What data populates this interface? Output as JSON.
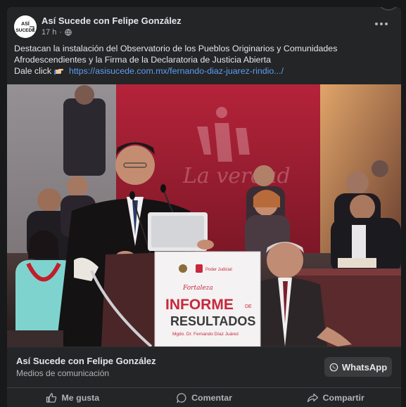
{
  "post": {
    "author": "Así Sucede con Felipe González",
    "time": "17 h",
    "separator": "·",
    "avatar_text_line1": "ASÍ",
    "avatar_text_line2": "SUCEDE",
    "text_line1": "Destacan la instalación del Observatorio de los Pueblos Originarios y Comunidades",
    "text_line2": "Afrodescendientes y la Firma de la Declaratoria de Justicia Abierta",
    "cta": "Dale click",
    "link": "https://asisucede.com.mx/fernando-diaz-juarez-rindio.../"
  },
  "photo": {
    "banner_small": "Poder Judicial",
    "banner_line1": "INFORME",
    "banner_de": "DE",
    "banner_line2": "RESULTADOS",
    "banner_name": "Mgdo. Dr. Fernando Díaz Juárez",
    "banner_script": "Fortaleza",
    "wall_script": "La verdad"
  },
  "link_preview": {
    "title": "Así Sucede con Felipe González",
    "subtitle": "Medios de comunicación",
    "button": "WhatsApp"
  },
  "actions": {
    "like": "Me gusta",
    "comment": "Comentar",
    "share": "Compartir"
  },
  "colors": {
    "background": "#18191a",
    "card": "#242526",
    "link": "#5d9cf6",
    "banner_red": "#c8283d"
  }
}
